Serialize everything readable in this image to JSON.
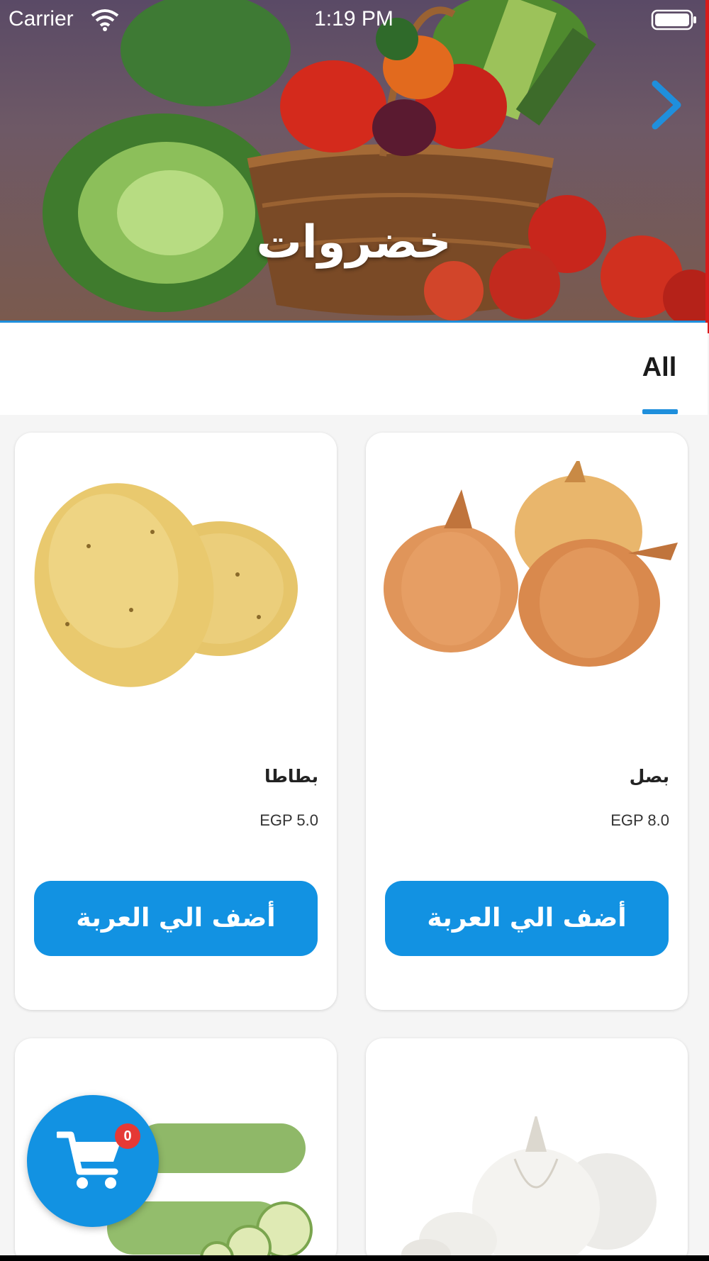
{
  "status_bar": {
    "carrier": "Carrier",
    "time": "1:19 PM"
  },
  "hero": {
    "title": "خضروات",
    "next_icon": "chevron-right-icon"
  },
  "tabs": [
    {
      "label": "All",
      "selected": true
    }
  ],
  "products": [
    {
      "name": "بصل",
      "price": "EGP 8.0",
      "button_label": "أضف الي العربة",
      "image": "onion"
    },
    {
      "name": "بطاطا",
      "price": "EGP 5.0",
      "button_label": "أضف الي العربة",
      "image": "potato"
    },
    {
      "name": "",
      "price": "",
      "button_label": "",
      "image": "garlic"
    },
    {
      "name": "",
      "price": "",
      "button_label": "",
      "image": "zucchini"
    }
  ],
  "cart": {
    "icon": "shopping-cart-icon",
    "count": "0"
  },
  "colors": {
    "accent": "#1292e2",
    "badge": "#e53935",
    "tab_indicator": "#1f8fdc"
  }
}
